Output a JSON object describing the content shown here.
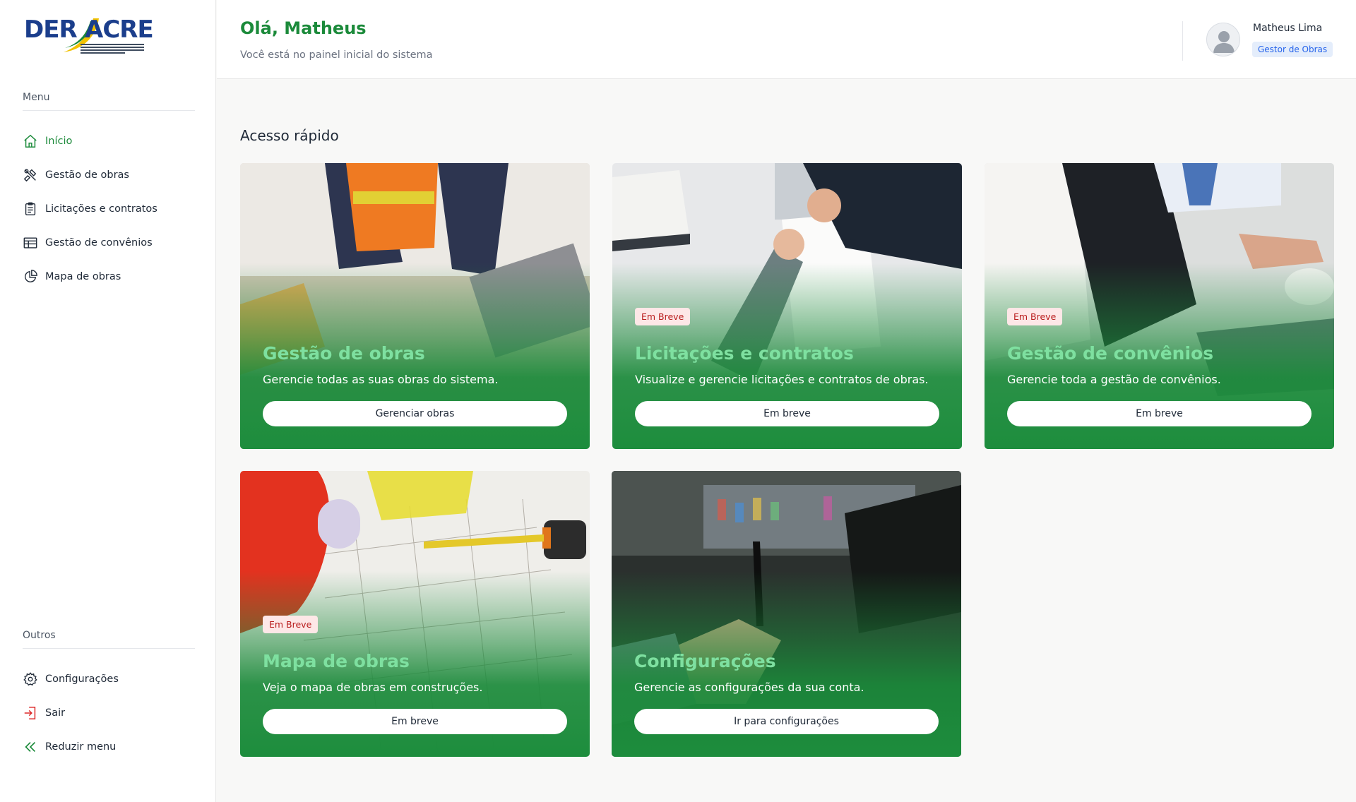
{
  "logo": {
    "text_left": "DER",
    "text_right": "ACRE"
  },
  "sidebar": {
    "menu_heading": "Menu",
    "items": [
      {
        "label": "Início",
        "icon": "home-icon",
        "active": true
      },
      {
        "label": "Gestão de obras",
        "icon": "tools-icon"
      },
      {
        "label": "Licitações e contratos",
        "icon": "clipboard-icon"
      },
      {
        "label": "Gestão de convênios",
        "icon": "table-icon"
      },
      {
        "label": "Mapa de obras",
        "icon": "pie-chart-icon"
      }
    ],
    "others_heading": "Outros",
    "others": [
      {
        "label": "Configurações",
        "icon": "gear-icon"
      },
      {
        "label": "Sair",
        "icon": "logout-icon"
      },
      {
        "label": "Reduzir menu",
        "icon": "double-chevron-left-icon"
      }
    ]
  },
  "header": {
    "greeting": "Olá, Matheus",
    "subtitle": "Você está no painel inicial do sistema",
    "user_name": "Matheus Lima",
    "user_role": "Gestor de Obras"
  },
  "main": {
    "section_title": "Acesso rápido",
    "cards": [
      {
        "title": "Gestão de obras",
        "description": "Gerencie todas as suas obras do sistema.",
        "button": "Gerenciar obras",
        "badge": ""
      },
      {
        "title": "Licitações e contratos",
        "description": "Visualize e gerencie licitações e contratos de obras.",
        "button": "Em breve",
        "badge": "Em Breve"
      },
      {
        "title": "Gestão de convênios",
        "description": "Gerencie toda a gestão de convênios.",
        "button": "Em breve",
        "badge": "Em Breve"
      },
      {
        "title": "Mapa de obras",
        "description": "Veja o mapa de obras em construções.",
        "button": "Em breve",
        "badge": "Em Breve"
      },
      {
        "title": "Configurações",
        "description": "Gerencie as configurações da sua conta.",
        "button": "Ir para configurações",
        "badge": ""
      }
    ]
  },
  "colors": {
    "brand_green": "#1b8a3a",
    "title_green": "#7ee0a0",
    "badge_red": "#b91c1c",
    "role_blue": "#2563eb"
  }
}
